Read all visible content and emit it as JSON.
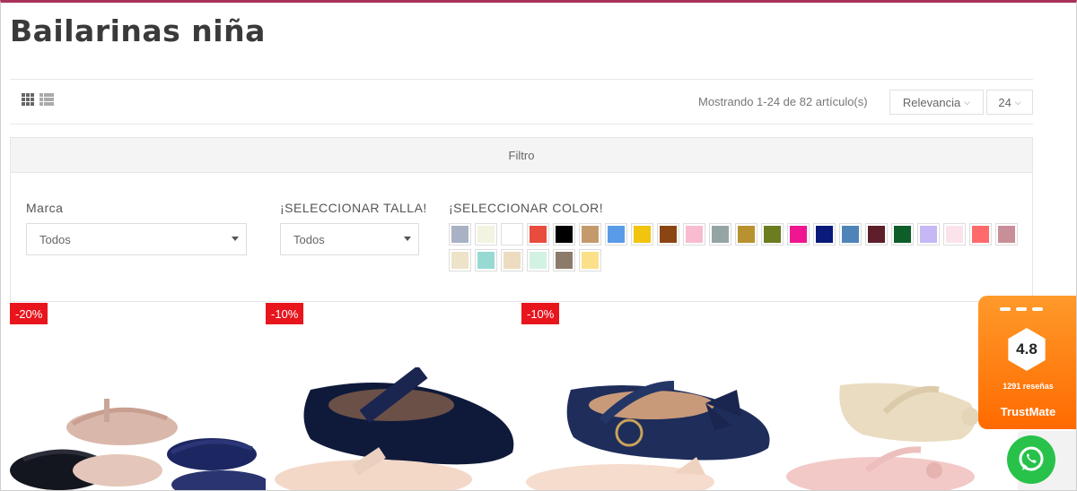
{
  "page": {
    "title": "Bailarinas niña"
  },
  "toolbar": {
    "grid_icon": "grid-view-icon",
    "list_icon": "list-view-icon",
    "showing_text": "Mostrando 1-24 de 82 artículo(s)",
    "sort_label": "Relevancia",
    "per_page_label": "24"
  },
  "filter": {
    "header": "Filtro",
    "brand_label": "Marca",
    "brand_value": "Todos",
    "size_label": "¡SELECCIONAR TALLA!",
    "size_value": "Todos",
    "color_label": "¡SELECCIONAR COLOR!",
    "colors": [
      "#a9b2c4",
      "#f3f3e2",
      "#ffffff",
      "#e74c3c",
      "#000000",
      "#c49a6c",
      "#5a9be8",
      "#f1c40f",
      "#8b4513",
      "#f8bbd0",
      "#95a5a6",
      "#b8922e",
      "#6b7d1f",
      "#f0168f",
      "#0a1a7a",
      "#4f84b8",
      "#5e1f2a",
      "#0e5e2a",
      "#c6b8f5",
      "#fbe3ec",
      "#ff6b6b",
      "#c98f98",
      "#ede3c8",
      "#98d9d4",
      "#eddcc0",
      "#d2f2e4",
      "#8c7b6a",
      "#fbe089"
    ]
  },
  "products": {
    "badges": [
      "-20%",
      "-10%",
      "-10%"
    ]
  },
  "widgets": {
    "trustmate_score": "4.8",
    "trustmate_count": "1291 reseñas",
    "trustmate_brand": "TrustMate",
    "whatsapp_icon": "whatsapp-icon"
  }
}
